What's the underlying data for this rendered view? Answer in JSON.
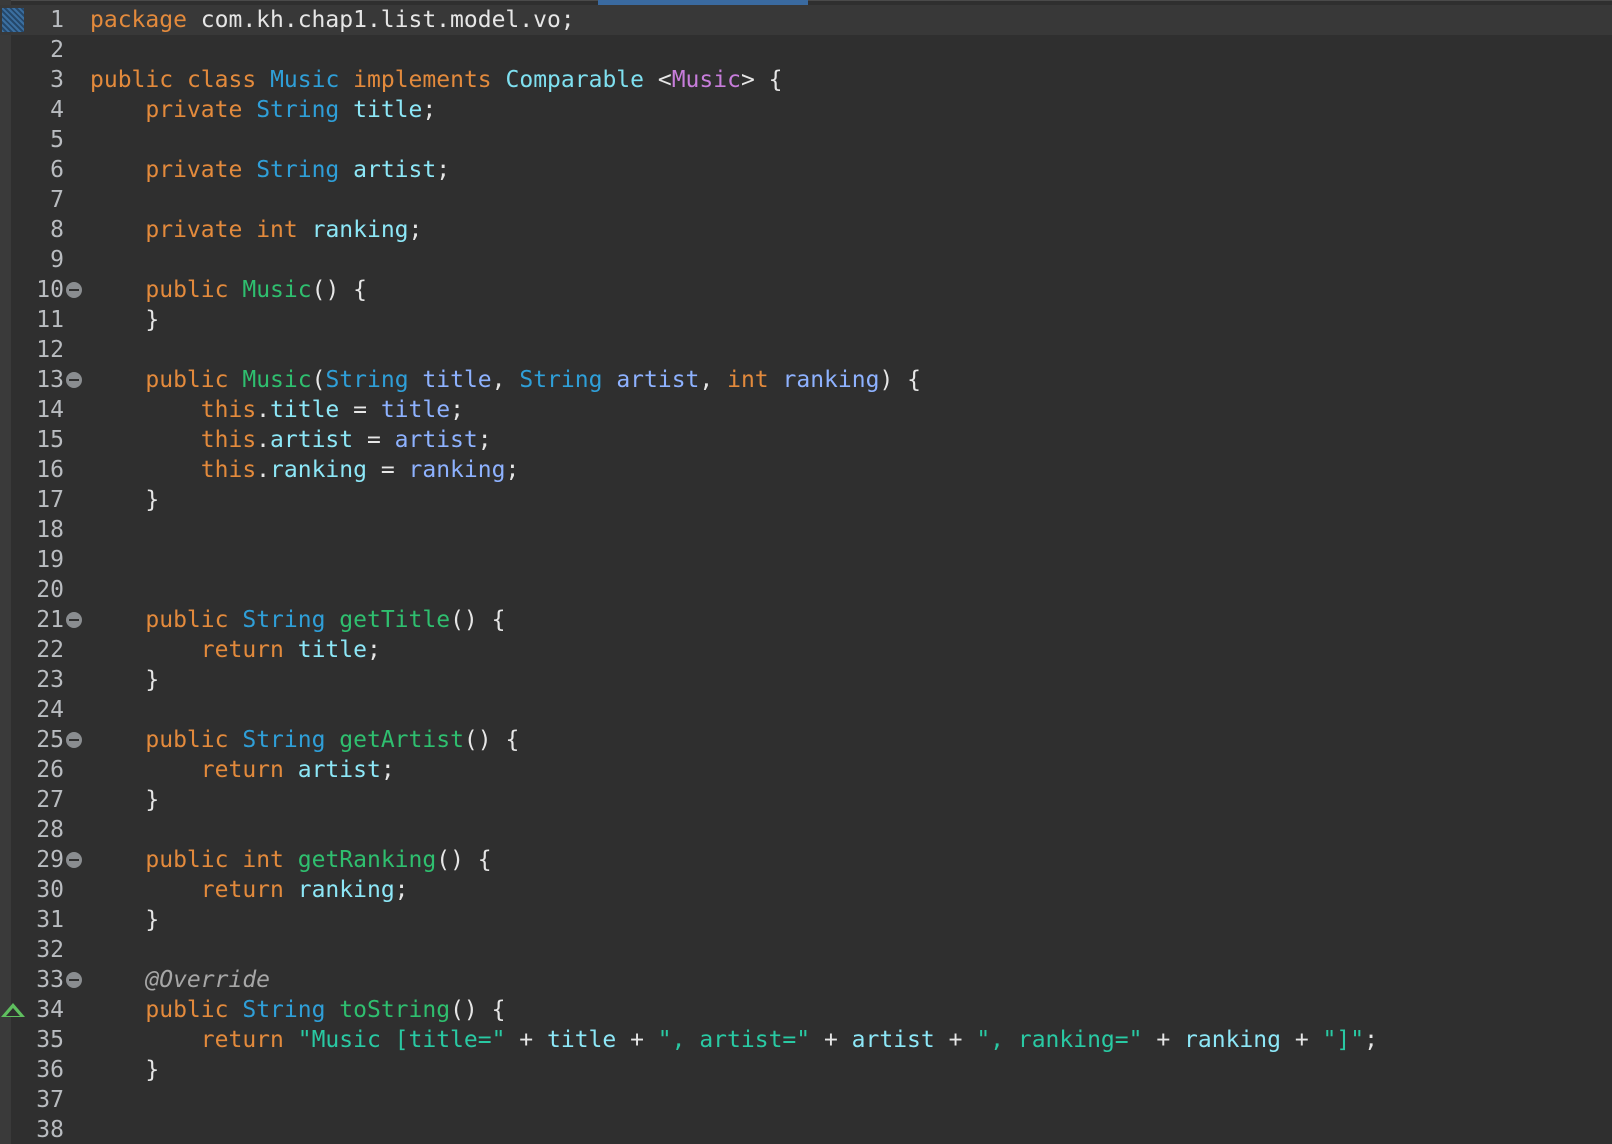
{
  "editor": {
    "lines": [
      {
        "num": "1",
        "current": true,
        "marker": "bookmark",
        "tokens": [
          {
            "t": "kw",
            "v": "package"
          },
          {
            "t": "pl",
            "v": " com.kh.chap1.list.model.vo;"
          }
        ]
      },
      {
        "num": "2",
        "tokens": []
      },
      {
        "num": "3",
        "tokens": [
          {
            "t": "kw",
            "v": "public"
          },
          {
            "t": "pl",
            "v": " "
          },
          {
            "t": "kw",
            "v": "class"
          },
          {
            "t": "pl",
            "v": " "
          },
          {
            "t": "ty",
            "v": "Music"
          },
          {
            "t": "pl",
            "v": " "
          },
          {
            "t": "kw",
            "v": "implements"
          },
          {
            "t": "pl",
            "v": " "
          },
          {
            "t": "cl",
            "v": "Comparable"
          },
          {
            "t": "pl",
            "v": " <"
          },
          {
            "t": "gen",
            "v": "Music"
          },
          {
            "t": "pl",
            "v": "> {"
          }
        ]
      },
      {
        "num": "4",
        "tokens": [
          {
            "t": "pl",
            "v": "    "
          },
          {
            "t": "kw",
            "v": "private"
          },
          {
            "t": "pl",
            "v": " "
          },
          {
            "t": "ty",
            "v": "String"
          },
          {
            "t": "pl",
            "v": " "
          },
          {
            "t": "fld",
            "v": "title"
          },
          {
            "t": "pl",
            "v": ";"
          }
        ]
      },
      {
        "num": "5",
        "tokens": []
      },
      {
        "num": "6",
        "tokens": [
          {
            "t": "pl",
            "v": "    "
          },
          {
            "t": "kw",
            "v": "private"
          },
          {
            "t": "pl",
            "v": " "
          },
          {
            "t": "ty",
            "v": "String"
          },
          {
            "t": "pl",
            "v": " "
          },
          {
            "t": "fld",
            "v": "artist"
          },
          {
            "t": "pl",
            "v": ";"
          }
        ]
      },
      {
        "num": "7",
        "tokens": []
      },
      {
        "num": "8",
        "tokens": [
          {
            "t": "pl",
            "v": "    "
          },
          {
            "t": "kw",
            "v": "private"
          },
          {
            "t": "pl",
            "v": " "
          },
          {
            "t": "kw",
            "v": "int"
          },
          {
            "t": "pl",
            "v": " "
          },
          {
            "t": "fld",
            "v": "ranking"
          },
          {
            "t": "pl",
            "v": ";"
          }
        ]
      },
      {
        "num": "9",
        "tokens": []
      },
      {
        "num": "10",
        "marker": "fold",
        "tokens": [
          {
            "t": "pl",
            "v": "    "
          },
          {
            "t": "kw",
            "v": "public"
          },
          {
            "t": "pl",
            "v": " "
          },
          {
            "t": "fn",
            "v": "Music"
          },
          {
            "t": "pl",
            "v": "() {"
          }
        ]
      },
      {
        "num": "11",
        "tokens": [
          {
            "t": "pl",
            "v": "    }"
          }
        ]
      },
      {
        "num": "12",
        "tokens": []
      },
      {
        "num": "13",
        "marker": "fold",
        "tokens": [
          {
            "t": "pl",
            "v": "    "
          },
          {
            "t": "kw",
            "v": "public"
          },
          {
            "t": "pl",
            "v": " "
          },
          {
            "t": "fn",
            "v": "Music"
          },
          {
            "t": "pl",
            "v": "("
          },
          {
            "t": "ty",
            "v": "String"
          },
          {
            "t": "pl",
            "v": " "
          },
          {
            "t": "par",
            "v": "title"
          },
          {
            "t": "pl",
            "v": ", "
          },
          {
            "t": "ty",
            "v": "String"
          },
          {
            "t": "pl",
            "v": " "
          },
          {
            "t": "par",
            "v": "artist"
          },
          {
            "t": "pl",
            "v": ", "
          },
          {
            "t": "kw",
            "v": "int"
          },
          {
            "t": "pl",
            "v": " "
          },
          {
            "t": "par",
            "v": "ranking"
          },
          {
            "t": "pl",
            "v": ") {"
          }
        ]
      },
      {
        "num": "14",
        "tokens": [
          {
            "t": "pl",
            "v": "        "
          },
          {
            "t": "kw",
            "v": "this"
          },
          {
            "t": "pl",
            "v": "."
          },
          {
            "t": "fld",
            "v": "title"
          },
          {
            "t": "pl",
            "v": " = "
          },
          {
            "t": "par",
            "v": "title"
          },
          {
            "t": "pl",
            "v": ";"
          }
        ]
      },
      {
        "num": "15",
        "tokens": [
          {
            "t": "pl",
            "v": "        "
          },
          {
            "t": "kw",
            "v": "this"
          },
          {
            "t": "pl",
            "v": "."
          },
          {
            "t": "fld",
            "v": "artist"
          },
          {
            "t": "pl",
            "v": " = "
          },
          {
            "t": "par",
            "v": "artist"
          },
          {
            "t": "pl",
            "v": ";"
          }
        ]
      },
      {
        "num": "16",
        "tokens": [
          {
            "t": "pl",
            "v": "        "
          },
          {
            "t": "kw",
            "v": "this"
          },
          {
            "t": "pl",
            "v": "."
          },
          {
            "t": "fld",
            "v": "ranking"
          },
          {
            "t": "pl",
            "v": " = "
          },
          {
            "t": "par",
            "v": "ranking"
          },
          {
            "t": "pl",
            "v": ";"
          }
        ]
      },
      {
        "num": "17",
        "tokens": [
          {
            "t": "pl",
            "v": "    }"
          }
        ]
      },
      {
        "num": "18",
        "tokens": []
      },
      {
        "num": "19",
        "tokens": []
      },
      {
        "num": "20",
        "tokens": []
      },
      {
        "num": "21",
        "marker": "fold",
        "tokens": [
          {
            "t": "pl",
            "v": "    "
          },
          {
            "t": "kw",
            "v": "public"
          },
          {
            "t": "pl",
            "v": " "
          },
          {
            "t": "ty",
            "v": "String"
          },
          {
            "t": "pl",
            "v": " "
          },
          {
            "t": "fn",
            "v": "getTitle"
          },
          {
            "t": "pl",
            "v": "() {"
          }
        ]
      },
      {
        "num": "22",
        "tokens": [
          {
            "t": "pl",
            "v": "        "
          },
          {
            "t": "kw",
            "v": "return"
          },
          {
            "t": "pl",
            "v": " "
          },
          {
            "t": "fld",
            "v": "title"
          },
          {
            "t": "pl",
            "v": ";"
          }
        ]
      },
      {
        "num": "23",
        "tokens": [
          {
            "t": "pl",
            "v": "    }"
          }
        ]
      },
      {
        "num": "24",
        "tokens": []
      },
      {
        "num": "25",
        "marker": "fold",
        "tokens": [
          {
            "t": "pl",
            "v": "    "
          },
          {
            "t": "kw",
            "v": "public"
          },
          {
            "t": "pl",
            "v": " "
          },
          {
            "t": "ty",
            "v": "String"
          },
          {
            "t": "pl",
            "v": " "
          },
          {
            "t": "fn",
            "v": "getArtist"
          },
          {
            "t": "pl",
            "v": "() {"
          }
        ]
      },
      {
        "num": "26",
        "tokens": [
          {
            "t": "pl",
            "v": "        "
          },
          {
            "t": "kw",
            "v": "return"
          },
          {
            "t": "pl",
            "v": " "
          },
          {
            "t": "fld",
            "v": "artist"
          },
          {
            "t": "pl",
            "v": ";"
          }
        ]
      },
      {
        "num": "27",
        "tokens": [
          {
            "t": "pl",
            "v": "    }"
          }
        ]
      },
      {
        "num": "28",
        "tokens": []
      },
      {
        "num": "29",
        "marker": "fold",
        "tokens": [
          {
            "t": "pl",
            "v": "    "
          },
          {
            "t": "kw",
            "v": "public"
          },
          {
            "t": "pl",
            "v": " "
          },
          {
            "t": "kw",
            "v": "int"
          },
          {
            "t": "pl",
            "v": " "
          },
          {
            "t": "fn",
            "v": "getRanking"
          },
          {
            "t": "pl",
            "v": "() {"
          }
        ]
      },
      {
        "num": "30",
        "tokens": [
          {
            "t": "pl",
            "v": "        "
          },
          {
            "t": "kw",
            "v": "return"
          },
          {
            "t": "pl",
            "v": " "
          },
          {
            "t": "fld",
            "v": "ranking"
          },
          {
            "t": "pl",
            "v": ";"
          }
        ]
      },
      {
        "num": "31",
        "tokens": [
          {
            "t": "pl",
            "v": "    }"
          }
        ]
      },
      {
        "num": "32",
        "tokens": []
      },
      {
        "num": "33",
        "marker": "fold",
        "tokens": [
          {
            "t": "pl",
            "v": "    "
          },
          {
            "t": "ann",
            "v": "@Override"
          }
        ]
      },
      {
        "num": "34",
        "marker": "override",
        "tokens": [
          {
            "t": "pl",
            "v": "    "
          },
          {
            "t": "kw",
            "v": "public"
          },
          {
            "t": "pl",
            "v": " "
          },
          {
            "t": "ty",
            "v": "String"
          },
          {
            "t": "pl",
            "v": " "
          },
          {
            "t": "fn",
            "v": "toString"
          },
          {
            "t": "pl",
            "v": "() {"
          }
        ]
      },
      {
        "num": "35",
        "tokens": [
          {
            "t": "pl",
            "v": "        "
          },
          {
            "t": "kw",
            "v": "return"
          },
          {
            "t": "pl",
            "v": " "
          },
          {
            "t": "str",
            "v": "\"Music [title=\""
          },
          {
            "t": "pl",
            "v": " + "
          },
          {
            "t": "fld",
            "v": "title"
          },
          {
            "t": "pl",
            "v": " + "
          },
          {
            "t": "str",
            "v": "\", artist=\""
          },
          {
            "t": "pl",
            "v": " + "
          },
          {
            "t": "fld",
            "v": "artist"
          },
          {
            "t": "pl",
            "v": " + "
          },
          {
            "t": "str",
            "v": "\", ranking=\""
          },
          {
            "t": "pl",
            "v": " + "
          },
          {
            "t": "fld",
            "v": "ranking"
          },
          {
            "t": "pl",
            "v": " + "
          },
          {
            "t": "str",
            "v": "\"]\""
          },
          {
            "t": "pl",
            "v": ";"
          }
        ]
      },
      {
        "num": "36",
        "tokens": [
          {
            "t": "pl",
            "v": "    }"
          }
        ]
      },
      {
        "num": "37",
        "tokens": []
      },
      {
        "num": "38",
        "tokens": []
      }
    ]
  }
}
